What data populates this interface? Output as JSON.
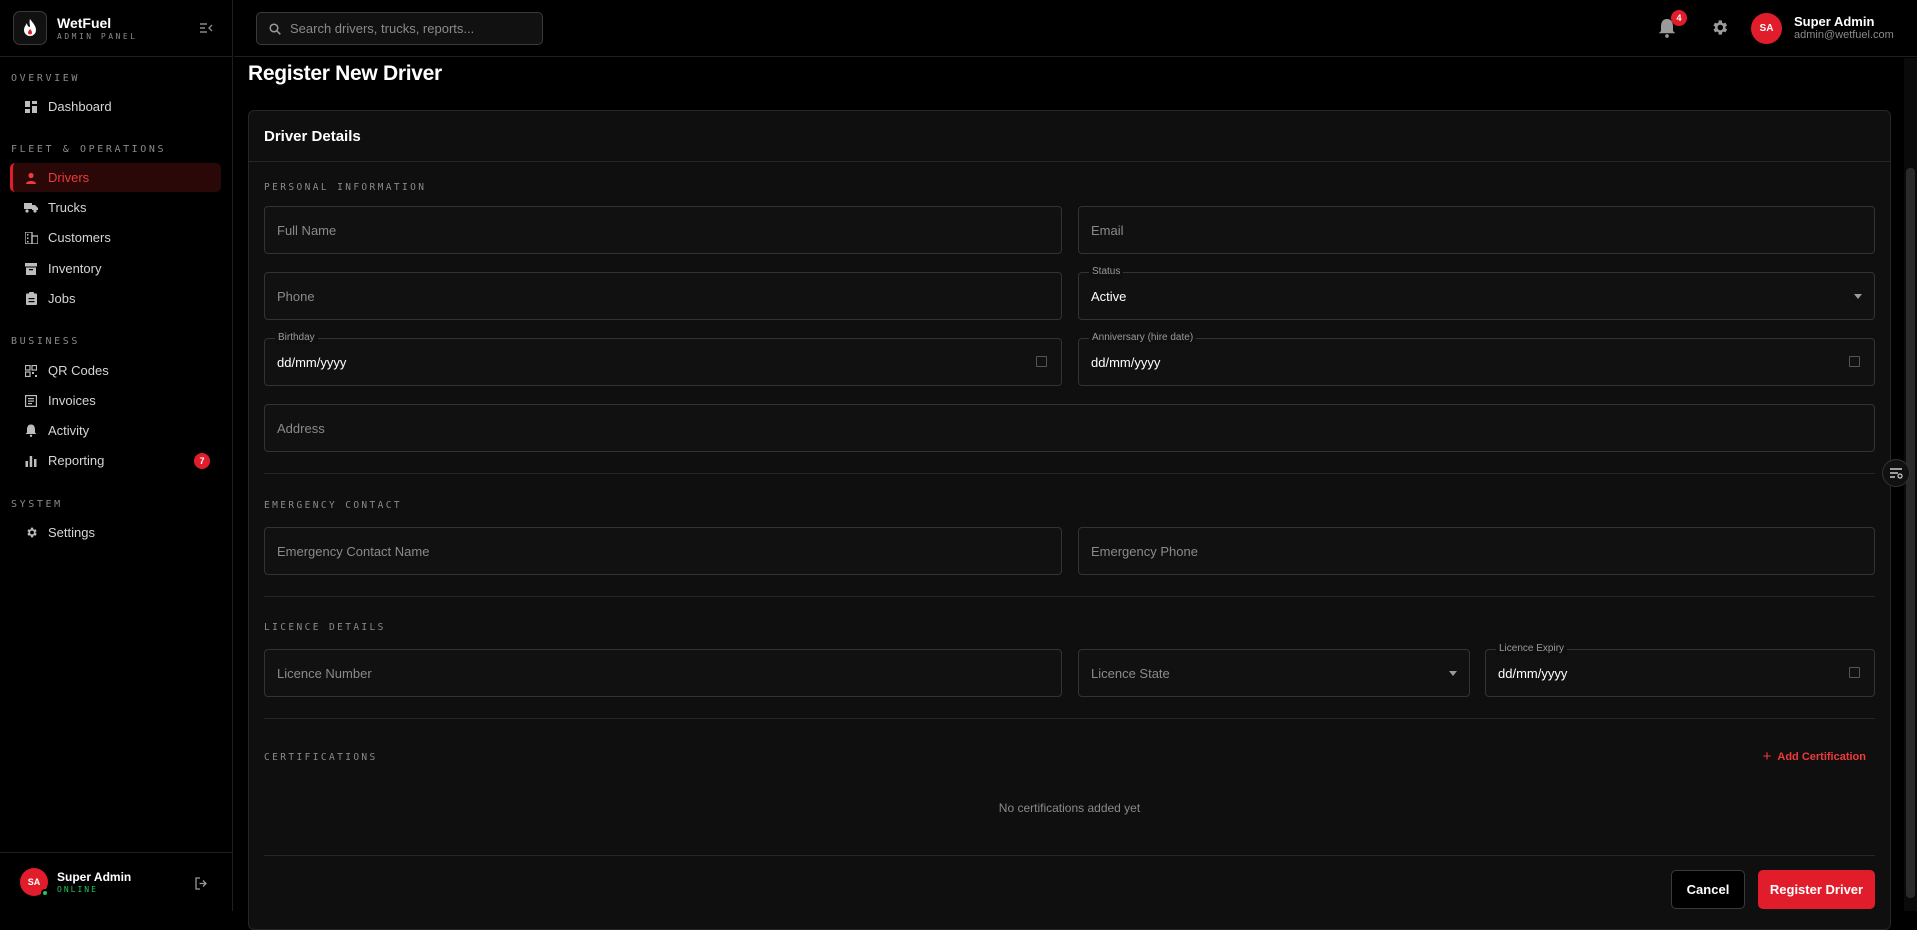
{
  "brand": {
    "name": "WetFuel",
    "subtitle": "ADMIN PANEL"
  },
  "sidebar": {
    "sections": [
      {
        "label": "OVERVIEW"
      },
      {
        "label": "FLEET & OPERATIONS"
      },
      {
        "label": "BUSINESS"
      },
      {
        "label": "SYSTEM"
      }
    ],
    "items": [
      {
        "label": "Dashboard",
        "icon": "dashboard-icon"
      },
      {
        "label": "Drivers",
        "icon": "person-icon",
        "active": true
      },
      {
        "label": "Trucks",
        "icon": "truck-icon"
      },
      {
        "label": "Customers",
        "icon": "building-icon"
      },
      {
        "label": "Inventory",
        "icon": "archive-icon"
      },
      {
        "label": "Jobs",
        "icon": "clipboard-icon"
      },
      {
        "label": "QR Codes",
        "icon": "qr-icon"
      },
      {
        "label": "Invoices",
        "icon": "invoice-icon"
      },
      {
        "label": "Activity",
        "icon": "bell-icon"
      },
      {
        "label": "Reporting",
        "icon": "bar-chart-icon",
        "badge": "7"
      },
      {
        "label": "Settings",
        "icon": "gear-icon"
      }
    ],
    "footer": {
      "initials": "SA",
      "name": "Super Admin",
      "status": "ONLINE"
    }
  },
  "header": {
    "search_placeholder": "Search drivers, trucks, reports...",
    "notification_count": "4",
    "user": {
      "initials": "SA",
      "name": "Super Admin",
      "email": "admin@wetfuel.com"
    }
  },
  "page": {
    "title": "Register New Driver",
    "card_title": "Driver Details",
    "sections": {
      "personal": "PERSONAL INFORMATION",
      "emergency": "EMERGENCY CONTACT",
      "licence": "LICENCE DETAILS",
      "certifications": "CERTIFICATIONS"
    },
    "fields": {
      "full_name": {
        "placeholder": "Full Name"
      },
      "email": {
        "placeholder": "Email"
      },
      "phone": {
        "placeholder": "Phone"
      },
      "status": {
        "label": "Status",
        "value": "Active"
      },
      "birthday": {
        "label": "Birthday",
        "value": "dd/mm/yyyy"
      },
      "anniversary": {
        "label": "Anniversary (hire date)",
        "value": "dd/mm/yyyy"
      },
      "address": {
        "placeholder": "Address"
      },
      "emergency_name": {
        "placeholder": "Emergency Contact Name"
      },
      "emergency_phone": {
        "placeholder": "Emergency Phone"
      },
      "licence_number": {
        "placeholder": "Licence Number"
      },
      "licence_state": {
        "value": "Licence State"
      },
      "licence_expiry": {
        "label": "Licence Expiry",
        "value": "dd/mm/yyyy"
      }
    },
    "add_certification": "Add Certification",
    "no_certifications": "No certifications added yet",
    "cancel": "Cancel",
    "submit": "Register Driver"
  },
  "colors": {
    "accent": "#e11d2b",
    "online": "#22c55e",
    "background": "#000000",
    "card": "#0f0f0f"
  }
}
